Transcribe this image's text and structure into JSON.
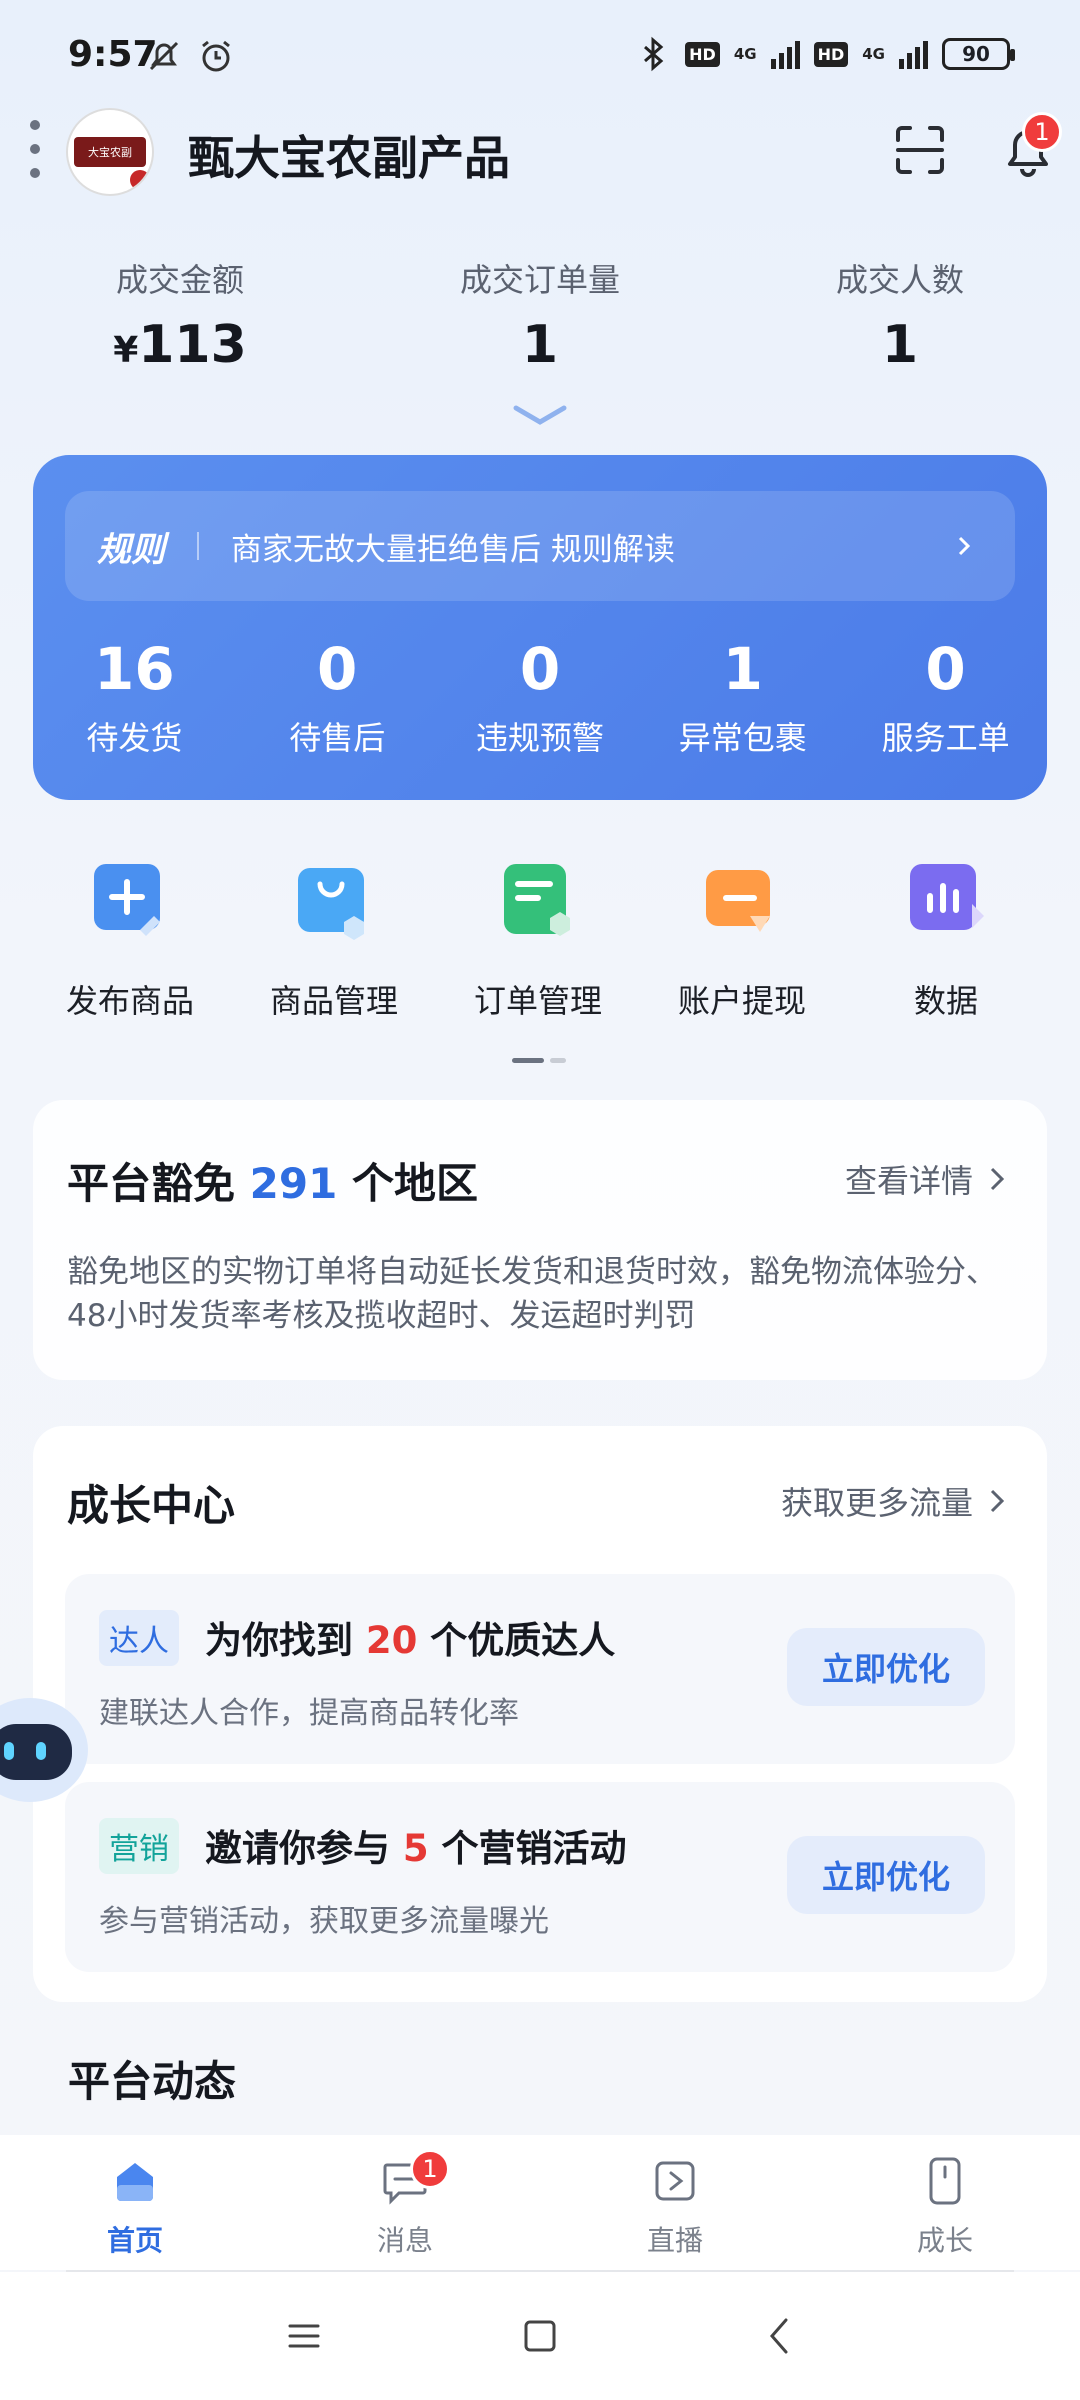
{
  "status": {
    "time": "9:57",
    "battery": "90",
    "net1": "4G",
    "net2": "4G",
    "hd": "HD"
  },
  "header": {
    "shop_name": "甄大宝农副产品",
    "logo_text": "大宝农副",
    "notif_count": "1"
  },
  "stats": [
    {
      "label": "成交金额",
      "currency": "¥",
      "value": "113"
    },
    {
      "label": "成交订单量",
      "value": "1"
    },
    {
      "label": "成交人数",
      "value": "1"
    }
  ],
  "rule": {
    "tag": "规则",
    "text": "商家无故大量拒绝售后 规则解读"
  },
  "work": [
    {
      "num": "16",
      "label": "待发货"
    },
    {
      "num": "0",
      "label": "待售后"
    },
    {
      "num": "0",
      "label": "违规预警"
    },
    {
      "num": "1",
      "label": "异常包裹"
    },
    {
      "num": "0",
      "label": "服务工单"
    }
  ],
  "apps": [
    {
      "label": "发布商品",
      "color": "#4a90f0"
    },
    {
      "label": "商品管理",
      "color": "#4aa8f5"
    },
    {
      "label": "订单管理",
      "color": "#34c07a"
    },
    {
      "label": "账户提现",
      "color": "#ff9b45"
    },
    {
      "label": "数据",
      "color": "#7b6cf0"
    }
  ],
  "exempt": {
    "title_prefix": "平台豁免",
    "title_count": "291",
    "title_suffix": "个地区",
    "link": "查看详情",
    "desc": "豁免地区的实物订单将自动延长发货和退货时效，豁免物流体验分、48小时发货率考核及揽收超时、发运超时判罚"
  },
  "growth": {
    "title": "成长中心",
    "link": "获取更多流量",
    "tasks": [
      {
        "tag": "达人",
        "pre": "为你找到",
        "count": "20",
        "post": "个优质达人",
        "sub": "建联达人合作，提高商品转化率",
        "button": "立即优化"
      },
      {
        "tag": "营销",
        "pre": "邀请你参与",
        "count": "5",
        "post": "个营销活动",
        "sub": "参与营销活动，获取更多流量曝光",
        "button": "立即优化"
      }
    ]
  },
  "platform_dynamics": {
    "title": "平台动态"
  },
  "tabs": [
    {
      "label": "首页",
      "active": true
    },
    {
      "label": "消息",
      "badge": "1"
    },
    {
      "label": "直播"
    },
    {
      "label": "成长"
    }
  ],
  "colors": {
    "primary": "#2f6de0",
    "card_blue": "#5b8fef",
    "badge_red": "#f03c3c",
    "count_red": "#e53935"
  }
}
